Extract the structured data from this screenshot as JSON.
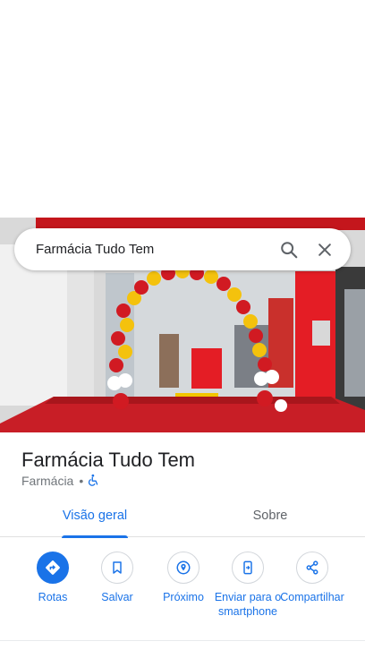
{
  "search": {
    "query": "Farmácia Tudo Tem"
  },
  "place": {
    "name": "Farmácia Tudo Tem",
    "category": "Farmácia",
    "separator": "•"
  },
  "tabs": [
    {
      "label": "Visão geral",
      "selected": true
    },
    {
      "label": "Sobre",
      "selected": false
    }
  ],
  "actions": [
    {
      "label": "Rotas",
      "icon": "directions-icon"
    },
    {
      "label": "Salvar",
      "icon": "bookmark-icon"
    },
    {
      "label": "Próximo",
      "icon": "nearby-icon"
    },
    {
      "label": "Enviar para o smartphone",
      "icon": "send-to-phone-icon"
    },
    {
      "label": "Compartilhar",
      "icon": "share-icon"
    }
  ],
  "colors": {
    "accent": "#1a73e8",
    "text": "#202124",
    "secondary": "#70757a"
  }
}
